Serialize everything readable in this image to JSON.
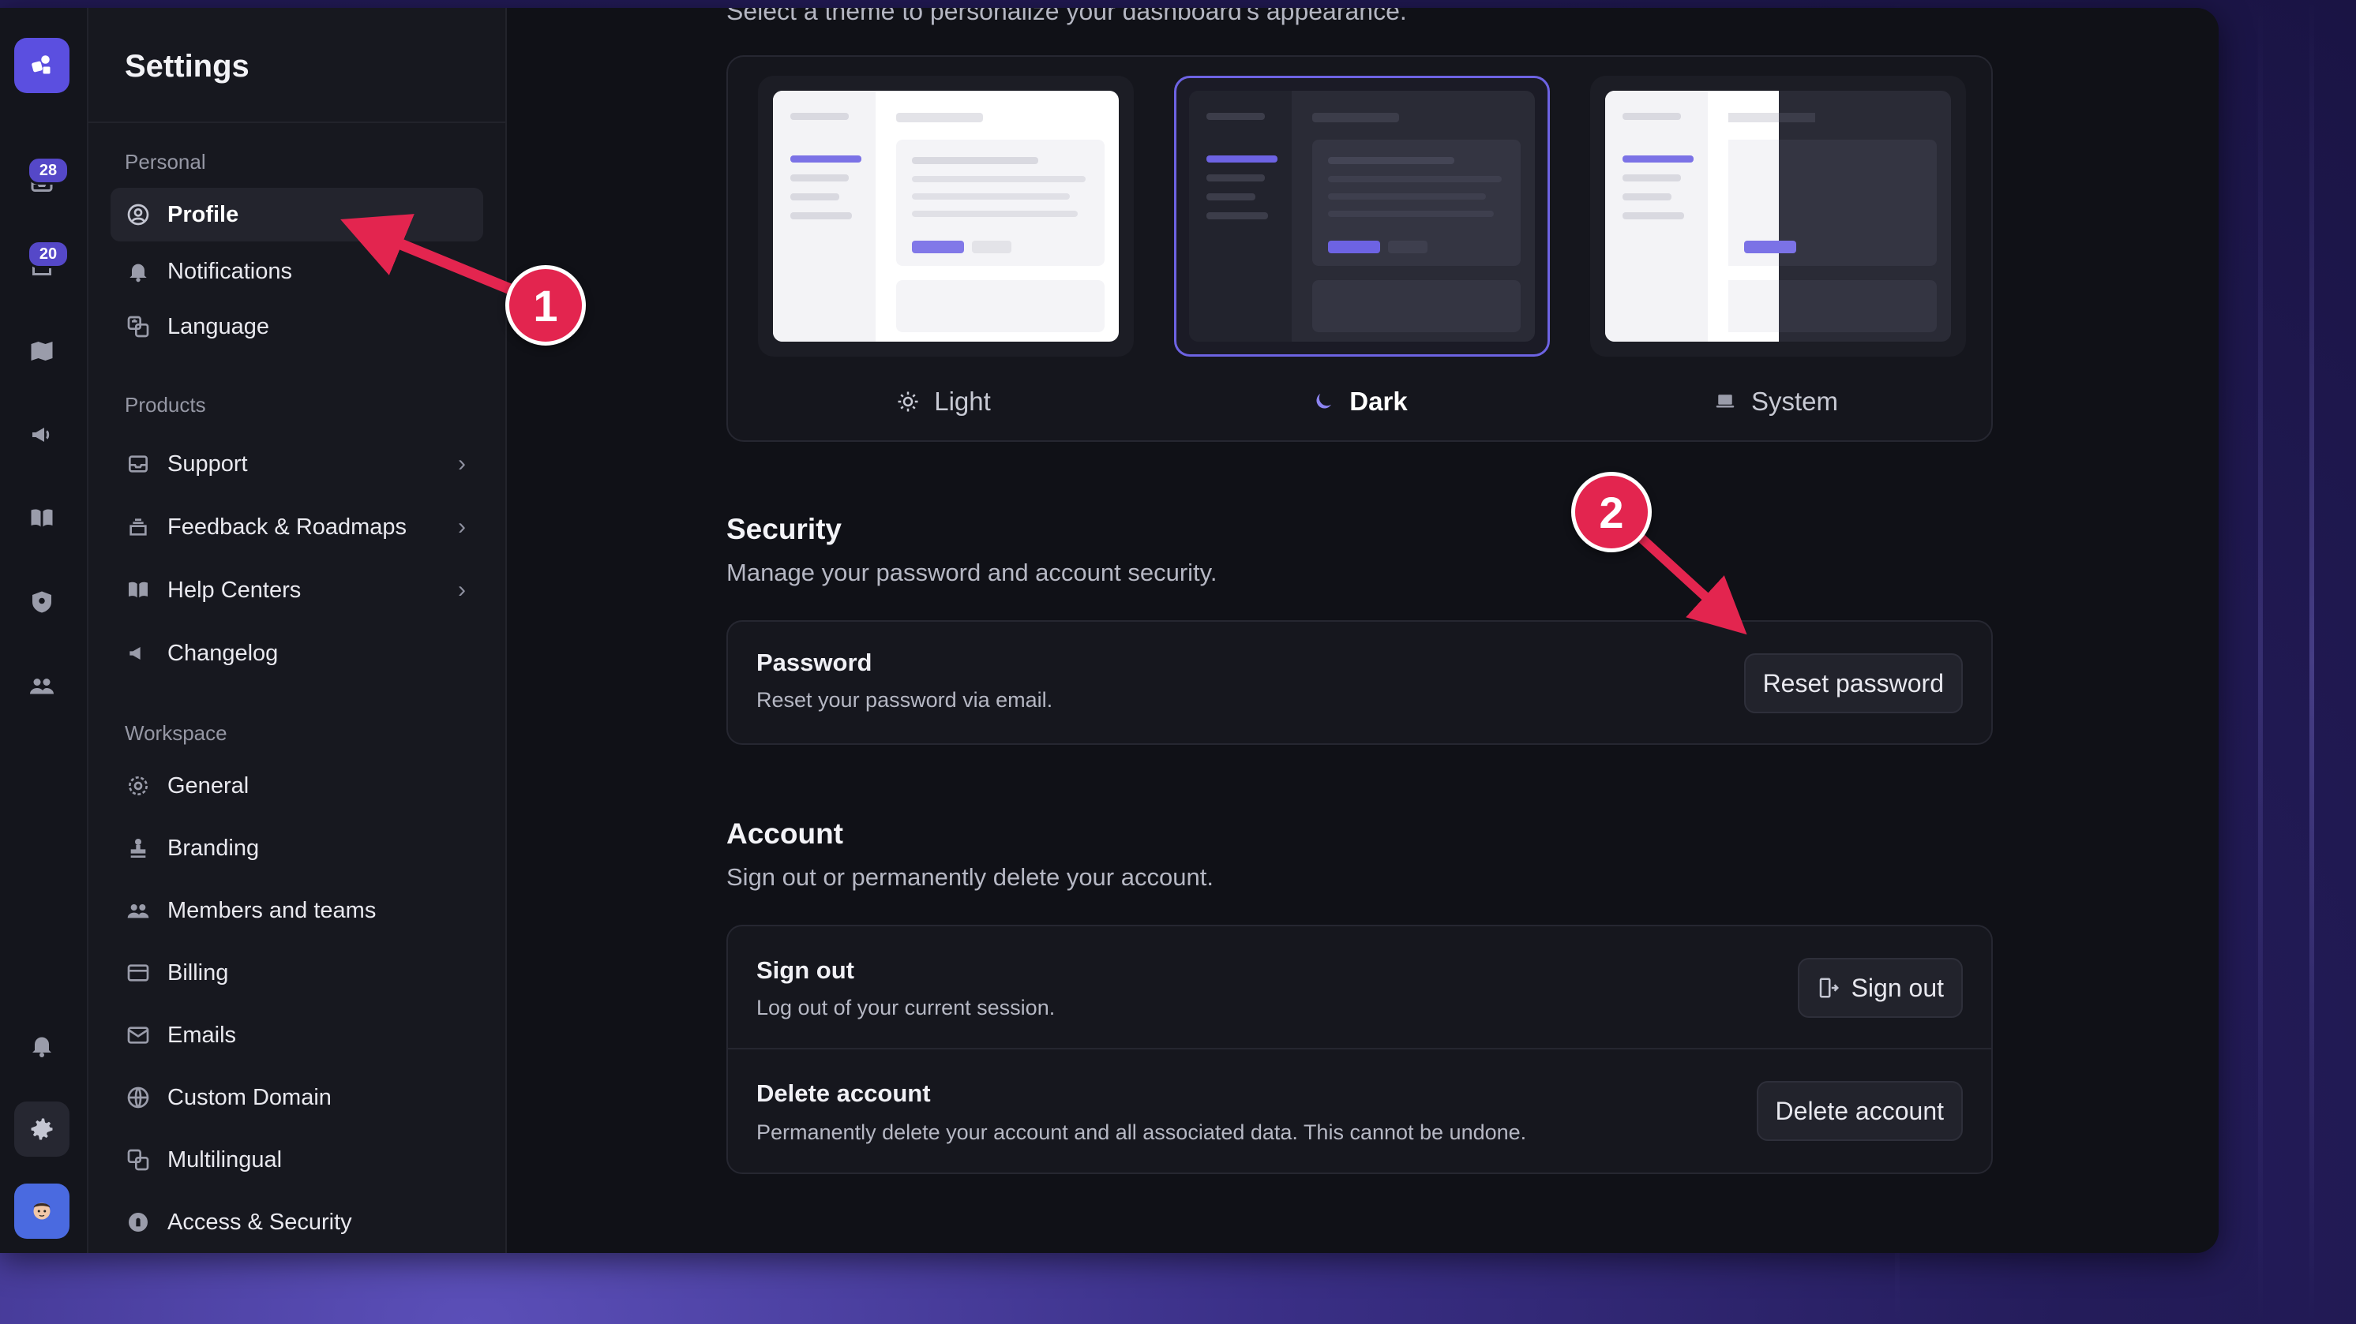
{
  "rail": {
    "inbox_badge": "28",
    "feedback_badge": "20"
  },
  "sidebar": {
    "title": "Settings",
    "sections": {
      "personal": "Personal",
      "products": "Products",
      "workspace": "Workspace"
    },
    "personal_items": [
      {
        "label": "Profile",
        "icon": "user-circle-icon"
      },
      {
        "label": "Notifications",
        "icon": "bell-icon"
      },
      {
        "label": "Language",
        "icon": "translate-icon"
      }
    ],
    "product_items": [
      {
        "label": "Support",
        "icon": "inbox-icon"
      },
      {
        "label": "Feedback & Roadmaps",
        "icon": "stack-icon"
      },
      {
        "label": "Help Centers",
        "icon": "book-icon"
      },
      {
        "label": "Changelog",
        "icon": "megaphone-icon"
      }
    ],
    "workspace_items": [
      {
        "label": "General",
        "icon": "gear-icon"
      },
      {
        "label": "Branding",
        "icon": "stamp-icon"
      },
      {
        "label": "Members and teams",
        "icon": "users-icon"
      },
      {
        "label": "Billing",
        "icon": "credit-card-icon"
      },
      {
        "label": "Emails",
        "icon": "envelope-icon"
      },
      {
        "label": "Custom Domain",
        "icon": "globe-icon"
      },
      {
        "label": "Multilingual",
        "icon": "translate-icon"
      },
      {
        "label": "Access & Security",
        "icon": "lock-icon"
      }
    ]
  },
  "theme": {
    "description": "Select a theme to personalize your dashboard's appearance.",
    "options": [
      {
        "label": "Light",
        "icon": "sun-icon"
      },
      {
        "label": "Dark",
        "icon": "moon-icon"
      },
      {
        "label": "System",
        "icon": "laptop-icon"
      }
    ],
    "selected": "Dark"
  },
  "security": {
    "title": "Security",
    "subtitle": "Manage your password and account security.",
    "password_title": "Password",
    "password_sub": "Reset your password via email.",
    "reset_button": "Reset password"
  },
  "account": {
    "title": "Account",
    "subtitle": "Sign out or permanently delete your account.",
    "signout_title": "Sign out",
    "signout_sub": "Log out of your current session.",
    "signout_button": "Sign out",
    "delete_title": "Delete account",
    "delete_sub": "Permanently delete your account and all associated data. This cannot be undone.",
    "delete_button": "Delete account"
  },
  "annotations": {
    "callout_1": "1",
    "callout_2": "2",
    "color": "#e3254f"
  },
  "colors": {
    "accent": "#6d63e3",
    "badge": "#5548c8"
  }
}
